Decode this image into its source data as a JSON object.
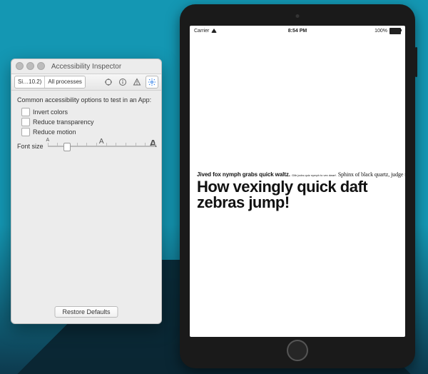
{
  "inspector": {
    "title": "Accessibility Inspector",
    "target_seg": {
      "left": "Si…10.2)",
      "right": "All processes"
    },
    "section_label": "Common accessibility options to test in an App:",
    "options": [
      {
        "label": "Invert colors",
        "checked": false
      },
      {
        "label": "Reduce transparency",
        "checked": false
      },
      {
        "label": "Reduce motion",
        "checked": false
      }
    ],
    "font_size_label": "Font size",
    "restore_label": "Restore Defaults"
  },
  "ipad": {
    "status": {
      "carrier": "Carrier",
      "time": "8:54 PM",
      "battery": "100%"
    },
    "line1a": "Jived fox nymph grabs quick waltz.",
    "line1b": "Glib jocks quiz nymph to vex dwarf.",
    "line1c": "Sphinx of black quartz, judge my vow.",
    "line2": "How vexingly quick daft zebras jump!"
  }
}
